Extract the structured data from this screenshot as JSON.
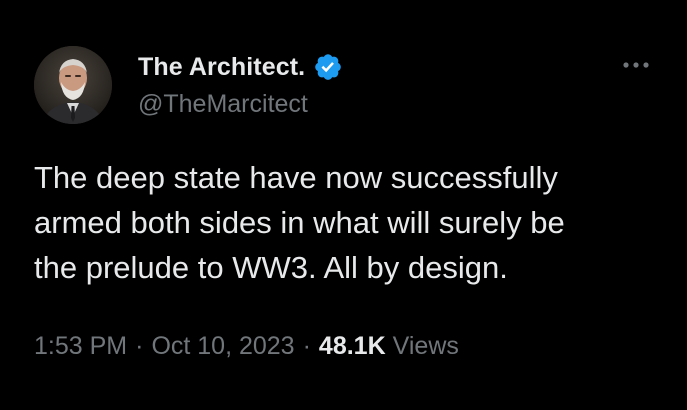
{
  "author": {
    "display_name": "The Architect.",
    "handle": "@TheMarcitect",
    "verified": true
  },
  "tweet": {
    "lines": [
      "The deep state have now successfully",
      "armed both sides in what will surely be",
      "the prelude to WW3. All by design."
    ],
    "time": "1:53 PM",
    "date": "Oct 10, 2023",
    "separator": "·",
    "views_count": "48.1K",
    "views_label": "Views"
  },
  "icons": {
    "verified": "verified-badge-icon",
    "more": "more-options-icon"
  },
  "colors": {
    "background": "#000000",
    "primary_text": "#e7e9ea",
    "secondary_text": "#71767b",
    "verified_blue": "#1d9bf0"
  }
}
